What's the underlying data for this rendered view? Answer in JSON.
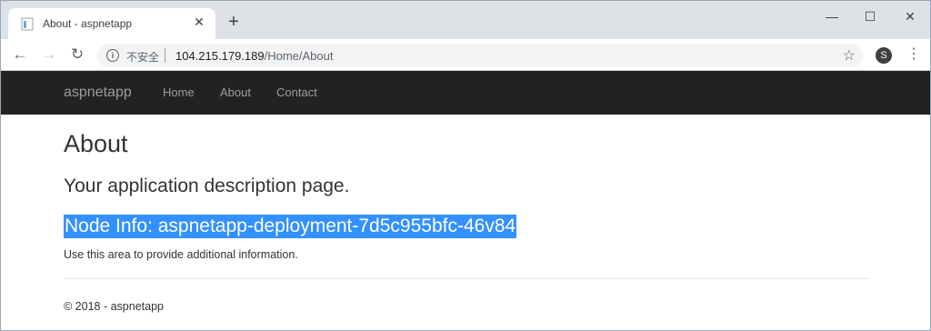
{
  "browser": {
    "tab_title": "About - aspnetapp",
    "new_tab_label": "+",
    "security_label": "不安全",
    "url_host": "104.215.179.189",
    "url_path": "/Home/About",
    "profile_initial": "S"
  },
  "site": {
    "brand": "aspnetapp",
    "nav": [
      "Home",
      "About",
      "Contact"
    ]
  },
  "main": {
    "title": "About",
    "subtitle": "Your application description page.",
    "node_info": "Node Info: aspnetapp-deployment-7d5c955bfc-46v84",
    "paragraph": "Use this area to provide additional information."
  },
  "footer": {
    "text": "© 2018 - aspnetapp"
  },
  "colors": {
    "navbar": "#222222",
    "selection": "#3390ff",
    "tabstrip": "#dee1e6"
  }
}
